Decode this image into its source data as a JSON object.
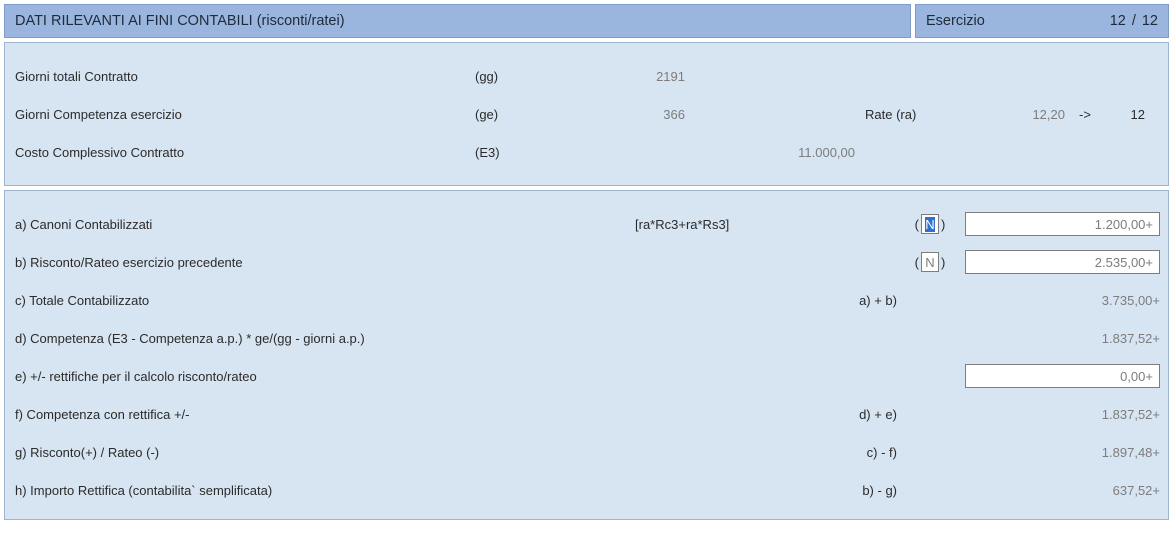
{
  "header": {
    "title": "DATI RILEVANTI AI FINI CONTABILI (risconti/ratei)",
    "esercizio_label": "Esercizio",
    "esercizio_cur": "12",
    "esercizio_slash": "/",
    "esercizio_tot": "12"
  },
  "summary": {
    "rows": [
      {
        "label": "Giorni totali Contratto",
        "code": "(gg)",
        "val1": "2191",
        "val2": "",
        "rate_label": "",
        "rate_val": "",
        "arrow": "",
        "rate_int": ""
      },
      {
        "label": "Giorni Competenza esercizio",
        "code": "(ge)",
        "val1": "366",
        "val2": "",
        "rate_label": "Rate (ra)",
        "rate_val": "12,20",
        "arrow": "->",
        "rate_int": "12"
      },
      {
        "label": "Costo Complessivo Contratto",
        "code": "(E3)",
        "val1": "",
        "val2": "11.000,00",
        "rate_label": "",
        "rate_val": "",
        "arrow": "",
        "rate_int": ""
      }
    ]
  },
  "calc": {
    "rows": [
      {
        "id": "a",
        "label": "a) Canoni Contabilizzati",
        "formula": "[ra*Rc3+ra*Rs3]",
        "eq_left": "(",
        "flag": "N",
        "eq_right": ")",
        "value": "1.200,00+",
        "input": true,
        "flagbox": true,
        "focused": true
      },
      {
        "id": "b",
        "label": "b) Risconto/Rateo esercizio precedente",
        "formula": "",
        "eq_left": "(",
        "flag": "N",
        "eq_right": ")",
        "value": "2.535,00+",
        "input": true,
        "flagbox": true,
        "focused": false
      },
      {
        "id": "c",
        "label": "c) Totale Contabilizzato",
        "formula": "",
        "eq": "a) + b)",
        "value": "3.735,00+",
        "input": false,
        "flagbox": false
      },
      {
        "id": "d",
        "label": "d) Competenza (E3 - Competenza a.p.) * ge/(gg - giorni a.p.)",
        "formula": "",
        "eq": "",
        "value": "1.837,52+",
        "input": false,
        "flagbox": false
      },
      {
        "id": "e",
        "label": "e) +/- rettifiche per il calcolo risconto/rateo",
        "formula": "",
        "eq": "",
        "value": "0,00+",
        "input": true,
        "flagbox": false
      },
      {
        "id": "f",
        "label": "f) Competenza con rettifica +/-",
        "formula": "",
        "eq": "d) + e)",
        "value": "1.837,52+",
        "input": false,
        "flagbox": false
      },
      {
        "id": "g",
        "label": "g) Risconto(+) / Rateo (-)",
        "formula": "",
        "eq": "c) - f)",
        "value": "1.897,48+",
        "input": false,
        "flagbox": false
      },
      {
        "id": "h",
        "label": "h) Importo Rettifica (contabilita` semplificata)",
        "formula": "",
        "eq": "b) - g)",
        "value": "637,52+",
        "input": false,
        "flagbox": false
      }
    ]
  }
}
